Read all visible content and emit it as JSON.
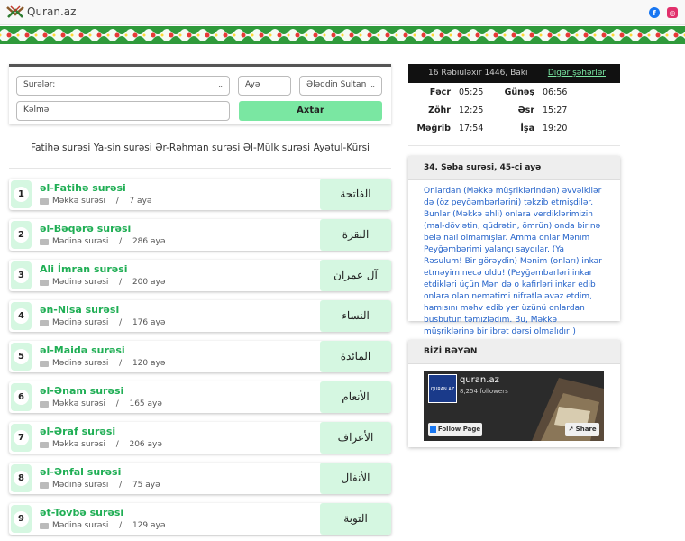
{
  "header": {
    "logo_text": "Quran.az",
    "social": [
      {
        "name": "facebook-icon",
        "glyph": "f"
      },
      {
        "name": "instagram-icon",
        "glyph": "◎"
      }
    ]
  },
  "search": {
    "surah_select": "Surələr:",
    "ayah_input": "Ayə",
    "translator_select": "Ələddin Sultan",
    "word_input": "Kəlmə",
    "submit_label": "Axtar"
  },
  "quick_links": [
    "Fatihə surəsi",
    "Ya-sin surəsi",
    "Ər-Rəhman surəsi",
    "Əl-Mülk surəsi",
    "Ayətul-Kürsi"
  ],
  "surahs": [
    {
      "num": "1",
      "name": "əl-Fatihə surəsi",
      "place": "Məkkə surəsi",
      "sep": "/",
      "ayahs": "7 ayə",
      "arabic": "الفاتحة"
    },
    {
      "num": "2",
      "name": "əl-Bəqərə surəsi",
      "place": "Mədinə surəsi",
      "sep": "/",
      "ayahs": "286 ayə",
      "arabic": "البقرة"
    },
    {
      "num": "3",
      "name": "Ali İmran surəsi",
      "place": "Mədinə surəsi",
      "sep": "/",
      "ayahs": "200 ayə",
      "arabic": "آل عمران"
    },
    {
      "num": "4",
      "name": "ən-Nisa surəsi",
      "place": "Mədinə surəsi",
      "sep": "/",
      "ayahs": "176 ayə",
      "arabic": "النساء"
    },
    {
      "num": "5",
      "name": "əl-Maidə surəsi",
      "place": "Mədinə surəsi",
      "sep": "/",
      "ayahs": "120 ayə",
      "arabic": "المائدة"
    },
    {
      "num": "6",
      "name": "əl-Ənam surəsi",
      "place": "Məkkə surəsi",
      "sep": "/",
      "ayahs": "165 ayə",
      "arabic": "الأنعام"
    },
    {
      "num": "7",
      "name": "əl-Əraf surəsi",
      "place": "Məkkə surəsi",
      "sep": "/",
      "ayahs": "206 ayə",
      "arabic": "الأعراف"
    },
    {
      "num": "8",
      "name": "əl-Ənfal surəsi",
      "place": "Mədinə surəsi",
      "sep": "/",
      "ayahs": "75 ayə",
      "arabic": "الأنفال"
    },
    {
      "num": "9",
      "name": "ət-Tovbə surəsi",
      "place": "Mədinə surəsi",
      "sep": "/",
      "ayahs": "129 ayə",
      "arabic": "التوبة"
    }
  ],
  "prayer": {
    "date": "16 Rəbiüləxır 1446, Bakı",
    "other_cities": "Digər şəhərlər",
    "times": [
      {
        "l1": "Fəcr",
        "v1": "05:25",
        "l2": "Günəş",
        "v2": "06:56"
      },
      {
        "l1": "Zöhr",
        "v1": "12:25",
        "l2": "Əsr",
        "v2": "15:27"
      },
      {
        "l1": "Məğrib",
        "v1": "17:54",
        "l2": "İşa",
        "v2": "19:20"
      }
    ]
  },
  "ayah_card": {
    "title": "34. Səba surəsi, 45-ci ayə",
    "text": "Onlardan (Məkkə müşriklərindən) əvvəlkilər də (öz peyğəmbərlərini) təkzib etmişdilər. Bunlar (Məkkə əhli) onlara verdiklərimizin (mal-dövlətin, qüdrətin, ömrün) onda birinə belə nail olmamışlar. Amma onlar Mənim Peyğəmbərimi yalançı saydılar. (Ya Rəsulum! Bir görəydin) Mənim (onları) inkar etməyim necə oldu! (Peyğəmbərləri inkar etdikləri üçün Mən də o kafirləri inkar edib onlara olan nemətimi nifrətlə əvəz etdim, hamısını məhv edib yer üzünü onlardan büsbütün təmizlədim. Bu, Məkkə müşriklərinə bir ibrət dərsi olmalıdır!)"
  },
  "like_card": {
    "title": "BİZİ BƏYƏN",
    "page_name": "quran.az",
    "followers": "8,254 followers",
    "thumb_label": "QURAN.AZ",
    "follow_label": "Follow Page",
    "share_label": "Share"
  }
}
